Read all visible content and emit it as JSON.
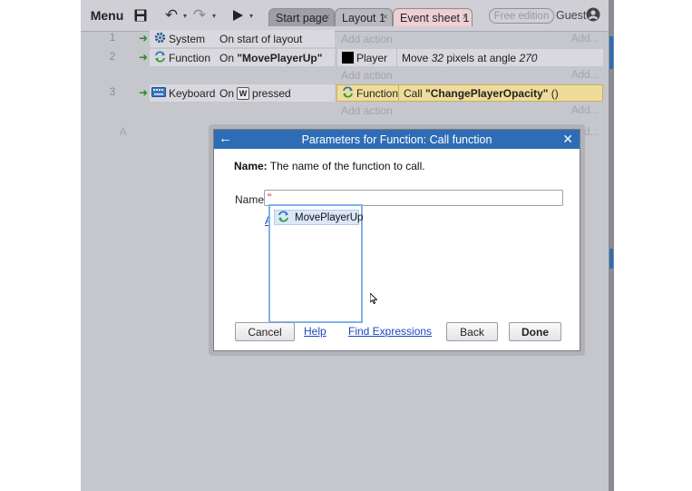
{
  "toolbar": {
    "menu_label": "Menu",
    "tabs": [
      {
        "label": "Start page",
        "close": "×"
      },
      {
        "label": "Layout 1",
        "close": "×"
      },
      {
        "label": "Event sheet 1",
        "close": "×"
      }
    ],
    "free_edition_label": "Free edition",
    "user_label": "Guest",
    "dropdown_glyph": "▾"
  },
  "events": {
    "event1": {
      "number": "1",
      "object": "System",
      "condition": "On start of layout",
      "add_action": "Add action",
      "add": "Add..."
    },
    "event2": {
      "number": "2",
      "object": "Function",
      "condition_prefix": "On ",
      "condition_name": "\"MovePlayerUp\"",
      "action_object": "Player",
      "action_text_1": "Move ",
      "action_value_1": "32",
      "action_text_2": " pixels at angle ",
      "action_value_2": "270",
      "add_action": "Add action",
      "add": "Add..."
    },
    "event3": {
      "number": "3",
      "object": "Keyboard",
      "condition_prefix": "On",
      "key": "W",
      "condition_suffix": "pressed",
      "action_object": "Function",
      "action_prefix": "Call ",
      "action_name": "\"ChangePlayerOpacity\"",
      "action_suffix": " ()",
      "add_action": "Add action",
      "add": "Add..."
    },
    "extra_add": "Add...",
    "partial_letter": "A"
  },
  "dialog": {
    "back_glyph": "←",
    "title": "Parameters for Function: Call function",
    "close_glyph": "✕",
    "desc_label": "Name:",
    "desc_text": " The name of the function to call.",
    "name_label": "Name",
    "name_value": "\"",
    "link_a": "A",
    "autocomplete_item": "MovePlayerUp",
    "cancel_label": "Cancel",
    "help_label": "Help",
    "find_expressions_label": "Find Expressions",
    "back_label": "Back",
    "done_label": "Done"
  },
  "colors": {
    "title_bar": "#2e6db6",
    "highlight_action": "#efdc9a",
    "event_tab": "#efcfd3",
    "link": "#1d46c0"
  }
}
